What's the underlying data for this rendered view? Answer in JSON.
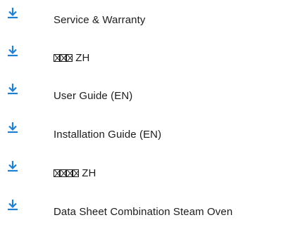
{
  "colors": {
    "icon": "#1f7fd0",
    "text": "#1c1c1c"
  },
  "documents": [
    {
      "label": "Service & Warranty",
      "icon": "download-icon"
    },
    {
      "label": "ZH",
      "glyph_boxes": 3,
      "icon": "download-icon"
    },
    {
      "label": "User Guide (EN)",
      "icon": "download-icon"
    },
    {
      "label": "Installation Guide (EN)",
      "icon": "download-icon"
    },
    {
      "label": "ZH",
      "glyph_boxes": 4,
      "icon": "download-icon"
    },
    {
      "label": "Data Sheet Combination Steam Oven",
      "icon": "download-icon"
    }
  ]
}
